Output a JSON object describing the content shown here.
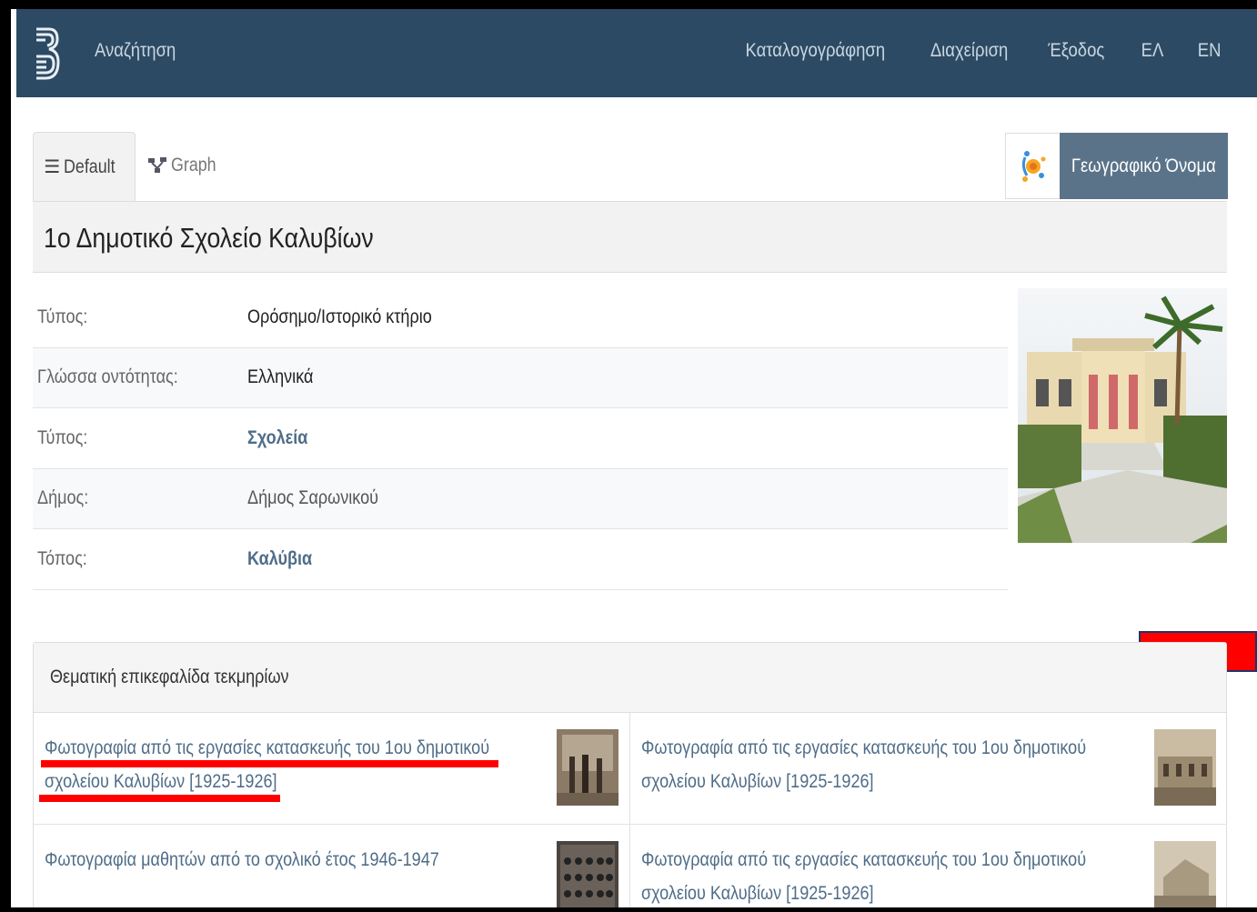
{
  "navbar": {
    "search_label": "Αναζήτηση",
    "items": [
      "Καταλογογράφηση",
      "Διαχείριση",
      "Έξοδος",
      "ΕΛ",
      "EN"
    ]
  },
  "tabs": {
    "default_label": "Default",
    "graph_label": "Graph"
  },
  "geo_button_label": "Γεωγραφικό Όνομα",
  "title": "1ο Δημοτικό Σχολείο Καλυβίων",
  "properties": [
    {
      "key": "Τύπος:",
      "value": "Ορόσημο/Ιστορικό κτήριο"
    },
    {
      "key": "Γλώσσα οντότητας:",
      "value": "Ελληνικά"
    },
    {
      "key": "Τύπος:",
      "value": "Σχολεία"
    },
    {
      "key": "Δήμος:",
      "value": "Δήμος Σαρωνικού"
    },
    {
      "key": "Τόπος:",
      "value": "Καλύβια"
    }
  ],
  "panel": {
    "heading": "Θεματική επικεφαλίδα τεκμηρίων",
    "items": [
      {
        "line1": "Φωτογραφία από τις εργασίες κατασκευής του 1ου δημοτικού",
        "line2": "σχολείου Καλυβίων [1925-1926]"
      },
      {
        "line1": "Φωτογραφία από τις εργασίες κατασκευής του 1ου δημοτικού",
        "line2": "σχολείου Καλυβίων [1925-1926]"
      },
      {
        "line1": "Φωτογραφία μαθητών από το σχολικό έτος 1946-1947",
        "line2": ""
      },
      {
        "line1": "Φωτογραφία από τις εργασίες κατασκευής του 1ου δημοτικού",
        "line2": "σχολείου Καλυβίων [1925-1926]"
      }
    ]
  },
  "colors": {
    "navbar": "#2c4a63",
    "link": "#4f6d88",
    "geo_button": "#5a7389",
    "highlight": "#ff0000"
  }
}
